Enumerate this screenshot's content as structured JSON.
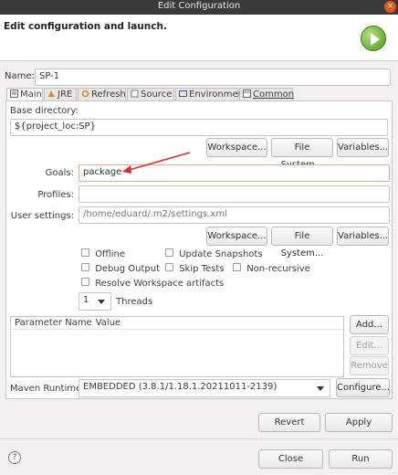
{
  "window": {
    "title": "Edit Configuration",
    "close": "×"
  },
  "header": {
    "message": "Edit configuration and launch."
  },
  "name": {
    "label": "Name:",
    "value": "SP-1"
  },
  "tabs": [
    {
      "label": "Main"
    },
    {
      "label": "JRE"
    },
    {
      "label": "Refresh"
    },
    {
      "label": "Source"
    },
    {
      "label": "Environment"
    },
    {
      "label": "Common"
    }
  ],
  "base_directory": {
    "label": "Base directory:",
    "value": "${project_loc:SP}",
    "buttons": {
      "workspace": "Workspace...",
      "filesystem": "File System...",
      "variables": "Variables..."
    }
  },
  "goals": {
    "label": "Goals:",
    "value": "package"
  },
  "profiles": {
    "label": "Profiles:",
    "value": ""
  },
  "user_settings": {
    "label": "User settings:",
    "value": "/home/eduard/.m2/settings.xml",
    "buttons": {
      "workspace": "Workspace...",
      "filesystem": "File System...",
      "variables": "Variables..."
    }
  },
  "options": {
    "offline": "Offline",
    "update_snapshots": "Update Snapshots",
    "debug_output": "Debug Output",
    "skip_tests": "Skip Tests",
    "non_recursive": "Non-recursive",
    "resolve_workspace": "Resolve Workspace artifacts"
  },
  "threads": {
    "value": "1",
    "label": "Threads"
  },
  "params_table": {
    "columns": [
      "Parameter Name",
      "Value"
    ],
    "buttons": {
      "add": "Add...",
      "edit": "Edit...",
      "remove": "Remove"
    }
  },
  "maven_runtime": {
    "label": "Maven Runtime:",
    "value": "EMBEDDED (3.8.1/1.18.1.20211011-2139)",
    "configure": "Configure..."
  },
  "actions": {
    "revert": "Revert",
    "apply": "Apply",
    "close": "Close",
    "run": "Run"
  },
  "help": "?",
  "colors": {
    "arrow": "#e02b2b",
    "goals_border": "#e9a89a",
    "title_bar": "#3a3a38",
    "close_button": "#e95420"
  }
}
